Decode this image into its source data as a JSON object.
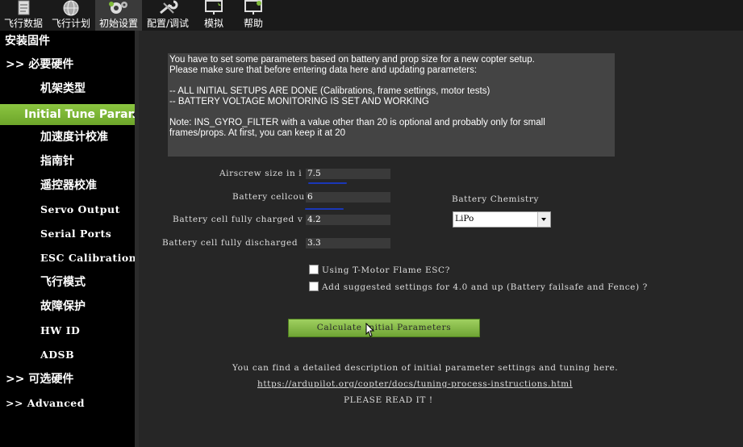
{
  "menu": [
    {
      "id": "flight-data",
      "label": "飞行数据",
      "icon": "clipboard-icon"
    },
    {
      "id": "flight-plan",
      "label": "飞行计划",
      "icon": "globe-icon"
    },
    {
      "id": "initial-setup",
      "label": "初始设置",
      "icon": "gears-icon"
    },
    {
      "id": "config-tuning",
      "label": "配置/调试",
      "icon": "wrench-icon"
    },
    {
      "id": "simulation",
      "label": "模拟",
      "icon": "monitor-plane-icon"
    },
    {
      "id": "help",
      "label": "帮助",
      "icon": "monitor-question-icon"
    }
  ],
  "sidebar": {
    "items": [
      {
        "label": "安装固件"
      },
      {
        "label": ">> 必要硬件"
      },
      {
        "label": "机架类型"
      },
      {
        "label": "Initial Tune Parameters"
      },
      {
        "label": "加速度计校准"
      },
      {
        "label": "指南针"
      },
      {
        "label": "遥控器校准"
      },
      {
        "label": "Servo Output"
      },
      {
        "label": "Serial Ports"
      },
      {
        "label": "ESC Calibration"
      },
      {
        "label": "飞行模式"
      },
      {
        "label": "故障保护"
      },
      {
        "label": "HW ID"
      },
      {
        "label": "ADSB"
      },
      {
        "label": ">> 可选硬件"
      },
      {
        "label": ">> Advanced"
      }
    ]
  },
  "notice": {
    "line1": "You have to set some parameters based on battery and prop size for a new copter setup.",
    "line2": "Please make sure that before entering data here and updating parameters:",
    "line3": "-- ALL INITIAL SETUPS ARE DONE (Calibrations, frame settings, motor tests)",
    "line4": "-- BATTERY VOLTAGE MONITORING IS SET AND WORKING",
    "line5": "Note: INS_GYRO_FILTER with a value other than 20 is optional and probably only for small",
    "line6": "frames/props. At first, you can keep it at 20"
  },
  "form": {
    "airscrew_label": "Airscrew size in i",
    "airscrew_value": "7.5",
    "cellcount_label": "Battery cellcou",
    "cellcount_value": "6",
    "charged_label": "Battery cell fully charged v",
    "charged_value": "4.2",
    "discharged_label": "Battery cell fully discharged",
    "discharged_value": "3.3",
    "chemistry_label": "Battery Chemistry",
    "chemistry_value": "LiPo",
    "tmotor_label": "Using T-Motor Flame ESC?",
    "suggested_label": "Add suggested settings for 4.0 and up (Battery failsafe and Fence) ?",
    "calc_button": "Calculate Initial Parameters"
  },
  "footer": {
    "desc": "You can find a detailed description of initial parameter settings and tuning here.",
    "link": "https://ardupilot.org/copter/docs/tuning-process-instructions.html",
    "readme": "PLEASE READ IT !"
  },
  "colors": {
    "accent": "#7fba3a",
    "panel": "#444444",
    "background": "#262626"
  }
}
